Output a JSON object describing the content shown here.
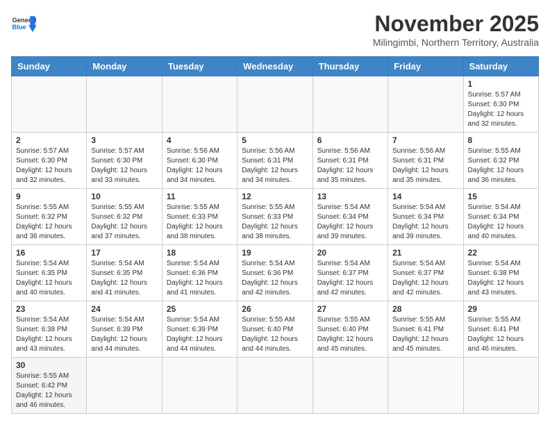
{
  "header": {
    "logo_general": "General",
    "logo_blue": "Blue",
    "month_title": "November 2025",
    "subtitle": "Milingimbi, Northern Territory, Australia"
  },
  "days_of_week": [
    "Sunday",
    "Monday",
    "Tuesday",
    "Wednesday",
    "Thursday",
    "Friday",
    "Saturday"
  ],
  "weeks": [
    [
      {
        "day": "",
        "info": ""
      },
      {
        "day": "",
        "info": ""
      },
      {
        "day": "",
        "info": ""
      },
      {
        "day": "",
        "info": ""
      },
      {
        "day": "",
        "info": ""
      },
      {
        "day": "",
        "info": ""
      },
      {
        "day": "1",
        "info": "Sunrise: 5:57 AM\nSunset: 6:30 PM\nDaylight: 12 hours and 32 minutes."
      }
    ],
    [
      {
        "day": "2",
        "info": "Sunrise: 5:57 AM\nSunset: 6:30 PM\nDaylight: 12 hours and 32 minutes."
      },
      {
        "day": "3",
        "info": "Sunrise: 5:57 AM\nSunset: 6:30 PM\nDaylight: 12 hours and 33 minutes."
      },
      {
        "day": "4",
        "info": "Sunrise: 5:56 AM\nSunset: 6:30 PM\nDaylight: 12 hours and 34 minutes."
      },
      {
        "day": "5",
        "info": "Sunrise: 5:56 AM\nSunset: 6:31 PM\nDaylight: 12 hours and 34 minutes."
      },
      {
        "day": "6",
        "info": "Sunrise: 5:56 AM\nSunset: 6:31 PM\nDaylight: 12 hours and 35 minutes."
      },
      {
        "day": "7",
        "info": "Sunrise: 5:56 AM\nSunset: 6:31 PM\nDaylight: 12 hours and 35 minutes."
      },
      {
        "day": "8",
        "info": "Sunrise: 5:55 AM\nSunset: 6:32 PM\nDaylight: 12 hours and 36 minutes."
      }
    ],
    [
      {
        "day": "9",
        "info": "Sunrise: 5:55 AM\nSunset: 6:32 PM\nDaylight: 12 hours and 36 minutes."
      },
      {
        "day": "10",
        "info": "Sunrise: 5:55 AM\nSunset: 6:32 PM\nDaylight: 12 hours and 37 minutes."
      },
      {
        "day": "11",
        "info": "Sunrise: 5:55 AM\nSunset: 6:33 PM\nDaylight: 12 hours and 38 minutes."
      },
      {
        "day": "12",
        "info": "Sunrise: 5:55 AM\nSunset: 6:33 PM\nDaylight: 12 hours and 38 minutes."
      },
      {
        "day": "13",
        "info": "Sunrise: 5:54 AM\nSunset: 6:34 PM\nDaylight: 12 hours and 39 minutes."
      },
      {
        "day": "14",
        "info": "Sunrise: 5:54 AM\nSunset: 6:34 PM\nDaylight: 12 hours and 39 minutes."
      },
      {
        "day": "15",
        "info": "Sunrise: 5:54 AM\nSunset: 6:34 PM\nDaylight: 12 hours and 40 minutes."
      }
    ],
    [
      {
        "day": "16",
        "info": "Sunrise: 5:54 AM\nSunset: 6:35 PM\nDaylight: 12 hours and 40 minutes."
      },
      {
        "day": "17",
        "info": "Sunrise: 5:54 AM\nSunset: 6:35 PM\nDaylight: 12 hours and 41 minutes."
      },
      {
        "day": "18",
        "info": "Sunrise: 5:54 AM\nSunset: 6:36 PM\nDaylight: 12 hours and 41 minutes."
      },
      {
        "day": "19",
        "info": "Sunrise: 5:54 AM\nSunset: 6:36 PM\nDaylight: 12 hours and 42 minutes."
      },
      {
        "day": "20",
        "info": "Sunrise: 5:54 AM\nSunset: 6:37 PM\nDaylight: 12 hours and 42 minutes."
      },
      {
        "day": "21",
        "info": "Sunrise: 5:54 AM\nSunset: 6:37 PM\nDaylight: 12 hours and 42 minutes."
      },
      {
        "day": "22",
        "info": "Sunrise: 5:54 AM\nSunset: 6:38 PM\nDaylight: 12 hours and 43 minutes."
      }
    ],
    [
      {
        "day": "23",
        "info": "Sunrise: 5:54 AM\nSunset: 6:38 PM\nDaylight: 12 hours and 43 minutes."
      },
      {
        "day": "24",
        "info": "Sunrise: 5:54 AM\nSunset: 6:39 PM\nDaylight: 12 hours and 44 minutes."
      },
      {
        "day": "25",
        "info": "Sunrise: 5:54 AM\nSunset: 6:39 PM\nDaylight: 12 hours and 44 minutes."
      },
      {
        "day": "26",
        "info": "Sunrise: 5:55 AM\nSunset: 6:40 PM\nDaylight: 12 hours and 44 minutes."
      },
      {
        "day": "27",
        "info": "Sunrise: 5:55 AM\nSunset: 6:40 PM\nDaylight: 12 hours and 45 minutes."
      },
      {
        "day": "28",
        "info": "Sunrise: 5:55 AM\nSunset: 6:41 PM\nDaylight: 12 hours and 45 minutes."
      },
      {
        "day": "29",
        "info": "Sunrise: 5:55 AM\nSunset: 6:41 PM\nDaylight: 12 hours and 46 minutes."
      }
    ],
    [
      {
        "day": "30",
        "info": "Sunrise: 5:55 AM\nSunset: 6:42 PM\nDaylight: 12 hours and 46 minutes."
      },
      {
        "day": "",
        "info": ""
      },
      {
        "day": "",
        "info": ""
      },
      {
        "day": "",
        "info": ""
      },
      {
        "day": "",
        "info": ""
      },
      {
        "day": "",
        "info": ""
      },
      {
        "day": "",
        "info": ""
      }
    ]
  ]
}
